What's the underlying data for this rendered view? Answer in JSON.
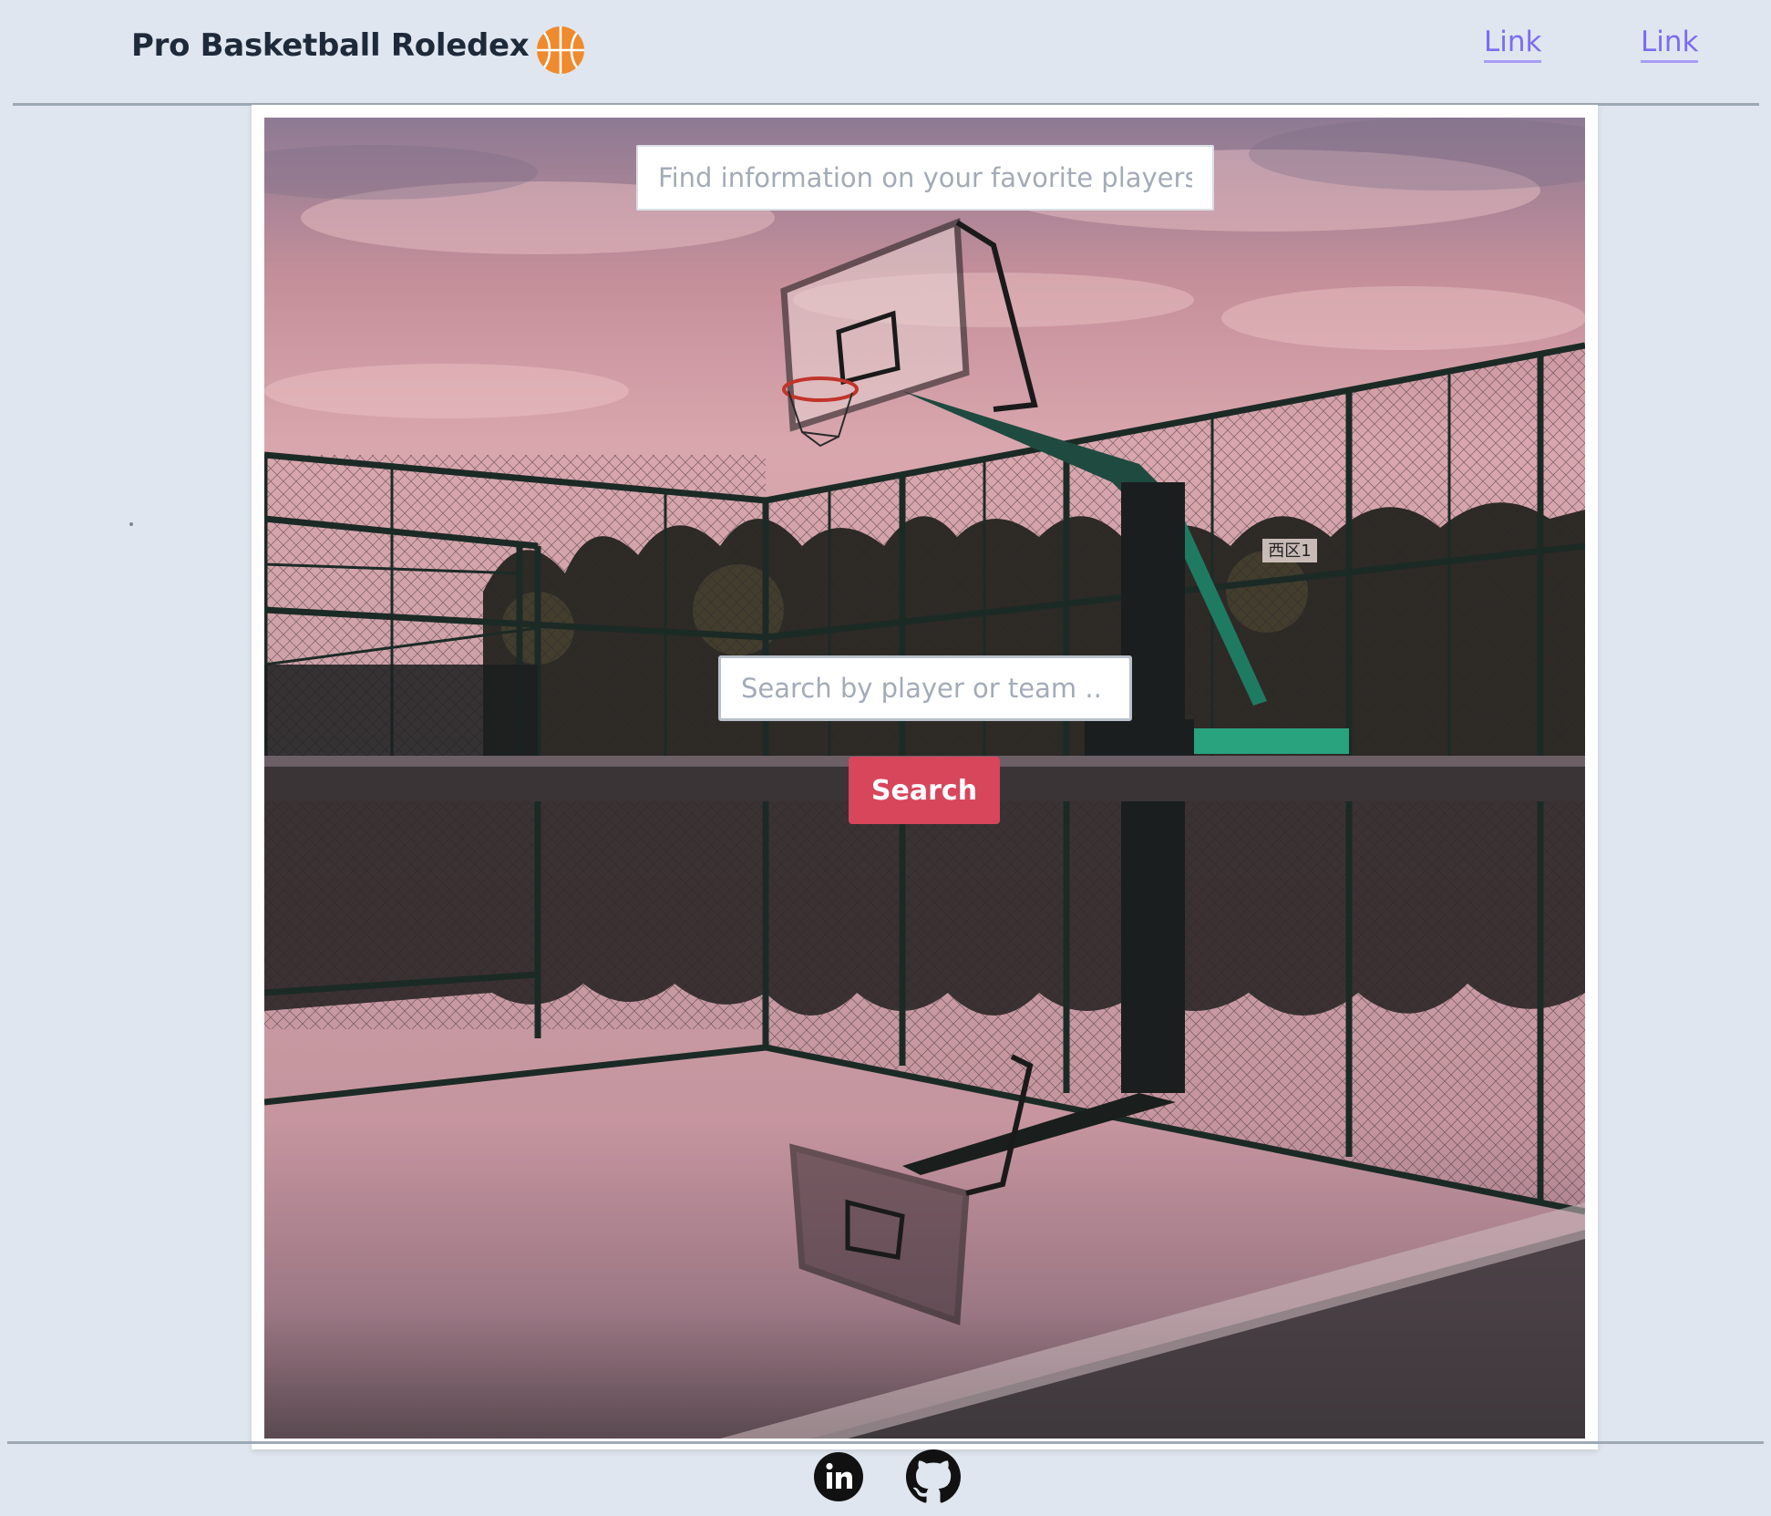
{
  "header": {
    "title": "Pro Basketball Roledex",
    "logo_icon": "basketball-icon",
    "links": [
      {
        "label": "Link"
      },
      {
        "label": "Link"
      }
    ]
  },
  "hero": {
    "info_placeholder": "Find information on your favorite players!",
    "search_placeholder": "Search by player or team ..",
    "search_button": "Search",
    "image_sign_text": "西区1"
  },
  "footer": {
    "social": [
      {
        "icon": "linkedin-icon"
      },
      {
        "icon": "github-icon"
      }
    ]
  },
  "colors": {
    "page_bg": "#e0e6ef",
    "title": "#1e2a3a",
    "link": "#7b6cf0",
    "button": "#d8465c",
    "logo": "#ef8a2e"
  }
}
